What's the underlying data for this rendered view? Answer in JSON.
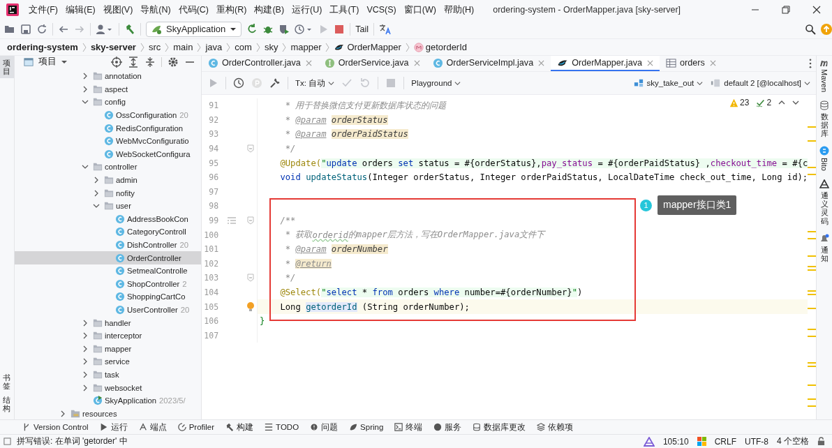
{
  "window": {
    "title": "ordering-system - OrderMapper.java [sky-server]"
  },
  "menu": [
    "文件(F)",
    "编辑(E)",
    "视图(V)",
    "导航(N)",
    "代码(C)",
    "重构(R)",
    "构建(B)",
    "运行(U)",
    "工具(T)",
    "VCS(S)",
    "窗口(W)",
    "帮助(H)"
  ],
  "toolbar": {
    "run_config": "SkyApplication",
    "tail": "Tail"
  },
  "breadcrumbs": [
    {
      "kind": "project",
      "label": "ordering-system"
    },
    {
      "kind": "module",
      "label": "sky-server"
    },
    {
      "kind": "dir",
      "label": "src"
    },
    {
      "kind": "dir",
      "label": "main"
    },
    {
      "kind": "dir",
      "label": "java"
    },
    {
      "kind": "dir",
      "label": "com"
    },
    {
      "kind": "dir",
      "label": "sky"
    },
    {
      "kind": "dir",
      "label": "mapper"
    },
    {
      "kind": "mapper",
      "label": "OrderMapper"
    },
    {
      "kind": "method",
      "label": "getorderId"
    }
  ],
  "left_strip": [
    {
      "label": "项目",
      "selected": true
    },
    {
      "label": "书签",
      "selected": false
    },
    {
      "label": "结构",
      "selected": false
    }
  ],
  "project_panel": {
    "title": "项目",
    "tree": [
      {
        "kind": "scrolled",
        "children": [
          {
            "kind": "scrolled",
            "children": [
              {
                "kind": "folder",
                "label": "annotation",
                "expanded": false,
                "selected": false
              },
              {
                "kind": "folder",
                "label": "aspect",
                "expanded": false,
                "selected": false
              },
              {
                "kind": "folder",
                "label": "config",
                "expanded": true,
                "selected": false,
                "children": [
                  {
                    "kind": "class",
                    "label": "OssConfiguration",
                    "suffix": "20",
                    "selected": false
                  },
                  {
                    "kind": "class",
                    "label": "RedisConfiguration",
                    "selected": false
                  },
                  {
                    "kind": "class",
                    "label": "WebMvcConfiguratio",
                    "selected": false
                  },
                  {
                    "kind": "class",
                    "label": "WebSocketConfigura",
                    "selected": false
                  }
                ]
              },
              {
                "kind": "folder",
                "label": "controller",
                "expanded": true,
                "selected": false,
                "children": [
                  {
                    "kind": "folder",
                    "label": "admin",
                    "expanded": false,
                    "selected": false
                  },
                  {
                    "kind": "folder",
                    "label": "nofity",
                    "expanded": false,
                    "selected": false
                  },
                  {
                    "kind": "folder",
                    "label": "user",
                    "expanded": true,
                    "selected": false,
                    "children": [
                      {
                        "kind": "class",
                        "label": "AddressBookCon",
                        "selected": false
                      },
                      {
                        "kind": "class",
                        "label": "CategoryControll",
                        "selected": false
                      },
                      {
                        "kind": "class",
                        "label": "DishController",
                        "suffix": "20",
                        "selected": false
                      },
                      {
                        "kind": "class",
                        "label": "OrderController",
                        "selected": true
                      },
                      {
                        "kind": "class",
                        "label": "SetmealControlle",
                        "selected": false
                      },
                      {
                        "kind": "class",
                        "label": "ShopController",
                        "suffix": "2",
                        "selected": false
                      },
                      {
                        "kind": "class",
                        "label": "ShoppingCartCo",
                        "selected": false
                      },
                      {
                        "kind": "class",
                        "label": "UserController",
                        "suffix": "20",
                        "selected": false
                      }
                    ]
                  }
                ]
              },
              {
                "kind": "folder",
                "label": "handler",
                "expanded": false,
                "selected": false
              },
              {
                "kind": "folder",
                "label": "interceptor",
                "expanded": false,
                "selected": false
              },
              {
                "kind": "folder",
                "label": "mapper",
                "expanded": false,
                "selected": false
              },
              {
                "kind": "folder",
                "label": "service",
                "expanded": false,
                "selected": false
              },
              {
                "kind": "folder",
                "label": "task",
                "expanded": false,
                "selected": false
              },
              {
                "kind": "folder",
                "label": "websocket",
                "expanded": false,
                "selected": false
              },
              {
                "kind": "app",
                "label": "SkyApplication",
                "suffix": "2023/5/",
                "selected": false
              }
            ]
          }
        ]
      },
      {
        "kind": "resfolder",
        "label": "resources",
        "expanded": false,
        "selected": false
      }
    ]
  },
  "tabs": [
    {
      "kind": "class",
      "label": "OrderController.java",
      "selected": false
    },
    {
      "kind": "interface",
      "label": "OrderService.java",
      "selected": false
    },
    {
      "kind": "class",
      "label": "OrderServiceImpl.java",
      "selected": false
    },
    {
      "kind": "mapper",
      "label": "OrderMapper.java",
      "selected": true
    },
    {
      "kind": "table",
      "label": "orders",
      "selected": false
    }
  ],
  "db_toolbar": {
    "tx": "Tx: 自动",
    "playground": "Playground",
    "schema": "sky_take_out",
    "datasource": "default 2 [@localhost]"
  },
  "inspections": {
    "warnings": "23",
    "checks": "2"
  },
  "code": [
    {
      "number": "91",
      "current": false,
      "tokens": [
        {
          "kind": "comment",
          "text": "     * 用于替换微信支付更新数据库状态的问题"
        }
      ]
    },
    {
      "number": "92",
      "current": false,
      "tokens": [
        {
          "kind": "comment",
          "text": "     * "
        },
        {
          "kind": "doctag",
          "text": "@param"
        },
        {
          "kind": "docparam",
          "text": "orderStatus"
        }
      ]
    },
    {
      "number": "93",
      "current": false,
      "tokens": [
        {
          "kind": "comment",
          "text": "     * "
        },
        {
          "kind": "doctag",
          "text": "@param"
        },
        {
          "kind": "docparam",
          "text": "orderPaidStatus"
        }
      ]
    },
    {
      "number": "94",
      "current": false,
      "fold": true,
      "tokens": [
        {
          "kind": "comment",
          "text": "     */"
        }
      ]
    },
    {
      "number": "95",
      "current": false,
      "tokens": [
        {
          "kind": "annot",
          "text": "    @Update("
        },
        {
          "kind": "str",
          "text": "\""
        },
        {
          "kind": "sqlkw",
          "text": "update"
        },
        {
          "kind": "sql",
          "text": " orders "
        },
        {
          "kind": "sqlkw",
          "text": "set"
        },
        {
          "kind": "sql",
          "text": " status = #{orderStatus},"
        },
        {
          "kind": "sqlcol",
          "text": "pay_status"
        },
        {
          "kind": "sql",
          "text": " = #{orderPaidStatus} ,"
        },
        {
          "kind": "sqlcol",
          "text": "checkout_time"
        },
        {
          "kind": "sql",
          "text": " = #{c"
        }
      ]
    },
    {
      "number": "96",
      "current": false,
      "tokens": [
        {
          "kind": "kw",
          "text": "    void "
        },
        {
          "kind": "decl",
          "text": "updateStatus"
        },
        {
          "kind": "plain",
          "text": "(Integer orderStatus, Integer orderPaidStatus, LocalDateTime check_out_time, Long id);"
        }
      ]
    },
    {
      "number": "97",
      "current": false
    },
    {
      "number": "98",
      "current": false
    },
    {
      "number": "99",
      "current": false,
      "fold": true,
      "doc": true,
      "tokens": [
        {
          "kind": "comment",
          "text": "    /**"
        }
      ]
    },
    {
      "number": "100",
      "current": false,
      "tokens": [
        {
          "kind": "comment",
          "text": "     * 获取"
        },
        {
          "kind": "typo",
          "text": "orderid"
        },
        {
          "kind": "comment",
          "text": "的mapper层方法，写在OrderMapper.java文件下"
        }
      ]
    },
    {
      "number": "101",
      "current": false,
      "tokens": [
        {
          "kind": "comment",
          "text": "     * "
        },
        {
          "kind": "doctag",
          "text": "@param"
        },
        {
          "kind": "docparam",
          "text": "orderNumber"
        }
      ]
    },
    {
      "number": "102",
      "current": false,
      "tokens": [
        {
          "kind": "comment",
          "text": "     * "
        },
        {
          "kind": "docreturn",
          "text": "@return"
        }
      ]
    },
    {
      "number": "103",
      "current": false,
      "fold": true,
      "tokens": [
        {
          "kind": "comment",
          "text": "     */"
        }
      ]
    },
    {
      "number": "104",
      "current": false,
      "tokens": [
        {
          "kind": "annot",
          "text": "    @Select("
        },
        {
          "kind": "str",
          "text": "\""
        },
        {
          "kind": "sqlkw",
          "text": "select"
        },
        {
          "kind": "sql",
          "text": " * "
        },
        {
          "kind": "sqlkw",
          "text": "from"
        },
        {
          "kind": "sql",
          "text": " orders "
        },
        {
          "kind": "sqlkw",
          "text": "where"
        },
        {
          "kind": "sql",
          "text": " number=#{orderNumber}"
        },
        {
          "kind": "str",
          "text": "\""
        },
        {
          "kind": "plain",
          "text": ")"
        }
      ]
    },
    {
      "number": "105",
      "current": true,
      "bulb": true,
      "tokens": [
        {
          "kind": "plain",
          "text": "    Long "
        },
        {
          "kind": "method",
          "text": "getorderId"
        },
        {
          "kind": "plain",
          "text": " (String orderNumber);"
        }
      ]
    },
    {
      "number": "106",
      "current": false,
      "tokens": [
        {
          "kind": "brace",
          "text": "}"
        }
      ]
    },
    {
      "number": "107",
      "current": false
    }
  ],
  "callout": {
    "number": "1",
    "label": "mapper接口类1"
  },
  "right_strip": [
    {
      "kind": "maven",
      "label": "Maven"
    },
    {
      "kind": "database",
      "label": "数据库"
    },
    {
      "kind": "bito",
      "label": "Bito"
    },
    {
      "kind": "lingma",
      "label": "通义灵码"
    },
    {
      "kind": "notifications",
      "label": "通知"
    }
  ],
  "tool_windows": [
    {
      "kind": "vcs",
      "label": "Version Control"
    },
    {
      "kind": "run",
      "label": "运行"
    },
    {
      "kind": "endpoints",
      "label": "端点"
    },
    {
      "kind": "profiler",
      "label": "Profiler"
    },
    {
      "kind": "build",
      "label": "构建"
    },
    {
      "kind": "todo",
      "label": "TODO"
    },
    {
      "kind": "problems",
      "label": "问题"
    },
    {
      "kind": "spring",
      "label": "Spring"
    },
    {
      "kind": "terminal",
      "label": "终端"
    },
    {
      "kind": "services",
      "label": "服务"
    },
    {
      "kind": "dbchanges",
      "label": "数据库更改"
    },
    {
      "kind": "deps",
      "label": "依赖项"
    }
  ],
  "status": {
    "message": "拼写错误: 在单词 'getorder' 中",
    "position": "105:10",
    "line_ending": "CRLF",
    "encoding": "UTF-8",
    "indent": "4 个空格"
  }
}
